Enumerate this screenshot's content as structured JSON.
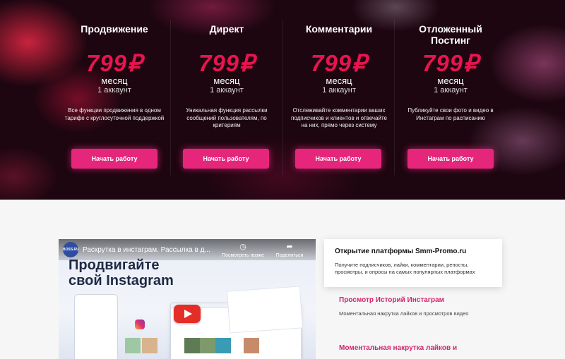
{
  "pricing": {
    "plans": [
      {
        "title": "Продвижение",
        "price": "799₽",
        "period": "месяц",
        "accounts": "1 аккаунт",
        "description": "Все функции продвижения в одном тарифе с круглосуточной поддержкой",
        "button": "Начать работу"
      },
      {
        "title": "Директ",
        "price": "799₽",
        "period": "месяц",
        "accounts": "1 аккаунт",
        "description": "Уникальная функция рассылки сообщений пользователям, по критериям",
        "button": "Начать работу"
      },
      {
        "title": "Комментарии",
        "price": "799₽",
        "period": "месяц",
        "accounts": "1 аккаунт",
        "description": "Отслеживайте комментарии ваших подписчиков и клиентов и отвечайте на них, прямо через систему",
        "button": "Начать работу"
      },
      {
        "title": "Отложенный Постинг",
        "price": "799₽",
        "period": "месяц",
        "accounts": "1 аккаунт",
        "description": "Публикуйте свои фото и видео в Инстаграм по расписанию",
        "button": "Начать работу"
      }
    ]
  },
  "video": {
    "channel_logo": "BOSS.RU",
    "title": "Раскрутка в инстаграм. Рассылка в д...",
    "watch_later": "Посмотреть позже",
    "share": "Поделиться",
    "headline_line1": "Продвигайте",
    "headline_line2": "свой Instagram"
  },
  "info_card": {
    "title": "Открытие платформы Smm-Promo.ru",
    "text": "Получите подписчиков, лайки, комментарии, репосты, просмотры, и опросы на самых популярных платформах"
  },
  "features": [
    {
      "title": "Просмотр Историй Инстаграм",
      "text": "Моментальная накрутка лайков и просмотров видео"
    },
    {
      "title": "Моментальная накрутка лайков и",
      "text": ""
    }
  ],
  "colors": {
    "accent_pink": "#e6267b",
    "price_red": "#e8144f",
    "feature_pink": "#d3246b"
  }
}
